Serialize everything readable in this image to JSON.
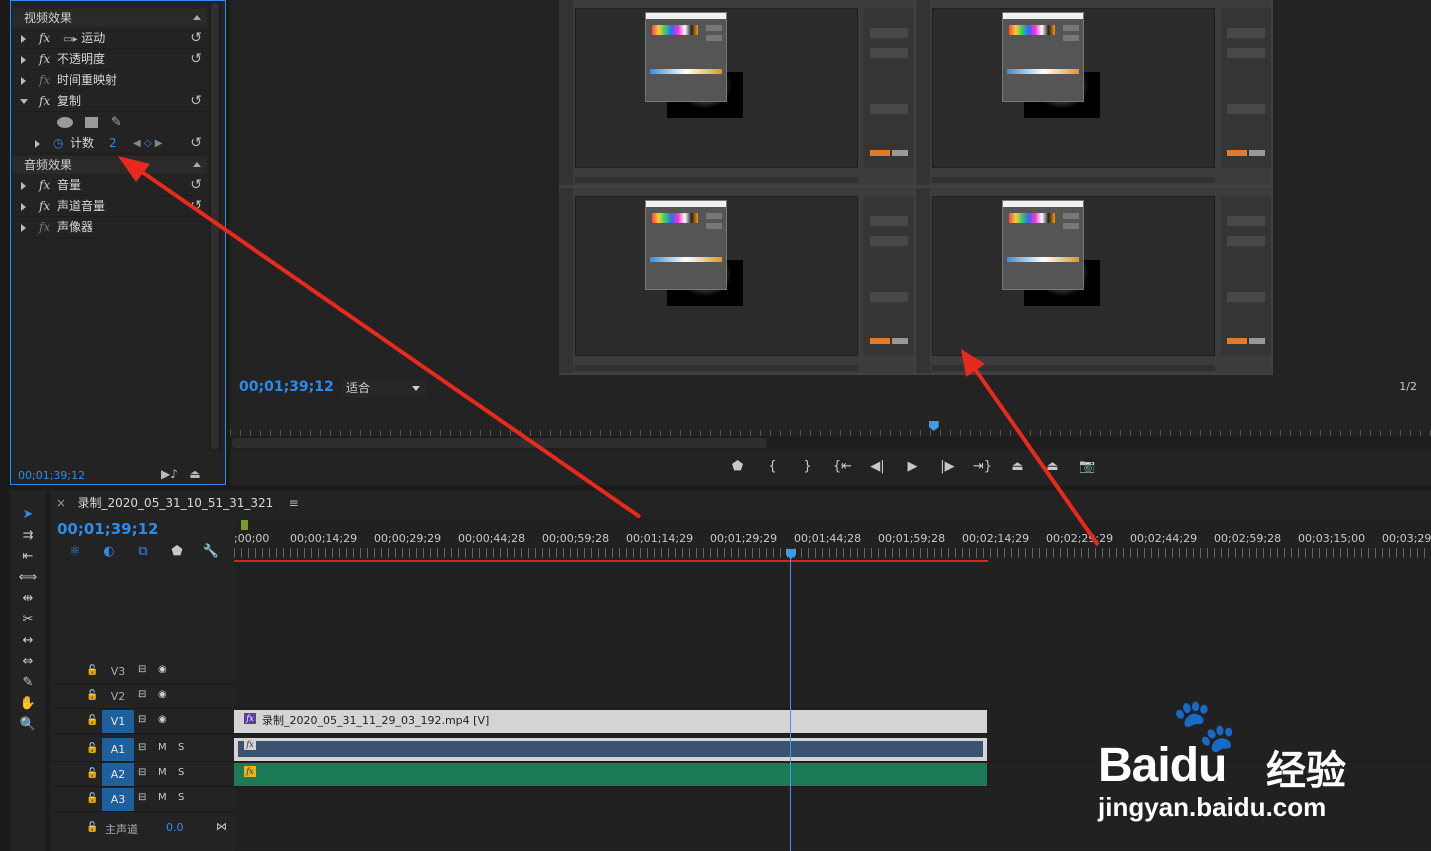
{
  "effects_panel": {
    "video_header": "视频效果",
    "audio_header": "音频效果",
    "video_effects": [
      {
        "label": "运动",
        "has_reset": true
      },
      {
        "label": "不透明度",
        "has_reset": true
      },
      {
        "label": "时间重映射",
        "has_reset": false
      },
      {
        "label": "复制",
        "has_reset": true
      }
    ],
    "param_label": "计数",
    "param_value": "2",
    "audio_effects": [
      {
        "label": "音量",
        "has_reset": true
      },
      {
        "label": "声道音量",
        "has_reset": true
      },
      {
        "label": "声像器",
        "has_reset": false
      }
    ],
    "timecode": "00;01;39;12"
  },
  "monitor": {
    "timecode": "00;01;39;12",
    "fit_label": "适合",
    "resolution": "1/2",
    "playhead_fraction": 0.586
  },
  "timeline": {
    "sequence_name": "录制_2020_05_31_10_51_31_321",
    "menu_glyph": "≡",
    "timecode": "00;01;39;12",
    "ruler_labels": [
      ";00;00",
      "00;00;14;29",
      "00;00;29;29",
      "00;00;44;28",
      "00;00;59;28",
      "00;01;14;29",
      "00;01;29;29",
      "00;01;44;28",
      "00;01;59;28",
      "00;02;14;29",
      "00;02;29;29",
      "00;02;44;29",
      "00;02;59;28",
      "00;03;15;00",
      "00;03;29;"
    ],
    "tracks": [
      {
        "name": "V3",
        "type": "video",
        "targeted": false
      },
      {
        "name": "V2",
        "type": "video",
        "targeted": false
      },
      {
        "name": "V1",
        "type": "video",
        "targeted": true
      },
      {
        "name": "A1",
        "type": "audio",
        "targeted": true
      },
      {
        "name": "A2",
        "type": "audio",
        "targeted": true
      },
      {
        "name": "A3",
        "type": "audio",
        "targeted": true
      }
    ],
    "video_clip_label": "录制_2020_05_31_11_29_03_192.mp4 [V]",
    "master_label": "主声道",
    "master_value": "0.0",
    "mute_label": "M",
    "solo_label": "S"
  },
  "colors": {
    "accent_blue": "#2d8ceb",
    "video_clip": "#d4d4d4",
    "audio_clip_a1": "#3a5370",
    "audio_clip_a2": "#1c7a56",
    "inout_bar": "#e02020",
    "annotation_arrow": "#e8291c"
  },
  "watermark": {
    "brand": "Bai",
    "brand2": "du",
    "cn": "经验",
    "url": "jingyan.baidu.com"
  }
}
